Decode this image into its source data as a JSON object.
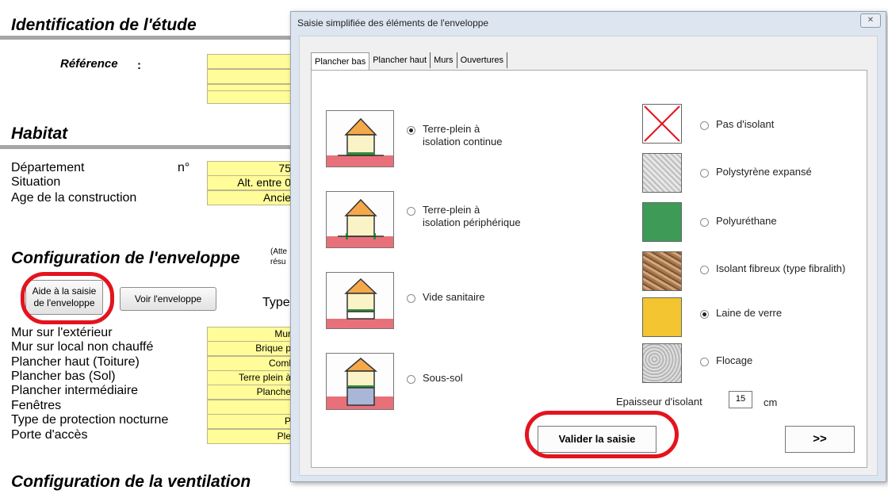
{
  "sheet": {
    "identification_title": "Identification de l'étude",
    "reference_label": "Référence",
    "reference_colon": ":",
    "habitat_title": "Habitat",
    "departement_label": "Département",
    "departement_no": "n°",
    "departement_value": "75",
    "situation_label": "Situation",
    "situation_value": "Alt. entre 0",
    "age_label": "Age de la construction",
    "age_value": "Ancie",
    "config_env_title": "Configuration de l'enveloppe",
    "config_note_1": "(Atte",
    "config_note_2": "résu",
    "aide_button_line1": "Aide à la saisie",
    "aide_button_line2": "de l'enveloppe",
    "voir_button": "Voir l'enveloppe",
    "type_label": "Type",
    "rows": [
      {
        "label": "Mur sur l'extérieur",
        "value": "Mur"
      },
      {
        "label": "Mur sur local non chauffé",
        "value": "Brique p"
      },
      {
        "label": "Plancher haut (Toiture)",
        "value": "Coml"
      },
      {
        "label": "Plancher bas (Sol)",
        "value": "Terre plein à"
      },
      {
        "label": "Plancher intermédiaire",
        "value": "Planche"
      },
      {
        "label": "Fenêtres",
        "value": ""
      },
      {
        "label": "Type de protection nocturne",
        "value": "P"
      },
      {
        "label": "Porte d'accès",
        "value": "Ple"
      }
    ],
    "config_vent_title": "Configuration de la ventilation"
  },
  "dialog": {
    "title": "Saisie simplifiée des éléments de l'enveloppe",
    "close_glyph": "✕",
    "tabs": [
      "Plancher bas",
      "Plancher haut",
      "Murs",
      "Ouvertures"
    ],
    "floor_types": [
      {
        "line1": "Terre-plein à",
        "line2": "isolation continue",
        "selected": true
      },
      {
        "line1": "Terre-plein à",
        "line2": "isolation périphérique",
        "selected": false
      },
      {
        "line1": "Vide sanitaire",
        "line2": "",
        "selected": false
      },
      {
        "line1": "Sous-sol",
        "line2": "",
        "selected": false
      }
    ],
    "materials": [
      {
        "label": "Pas d'isolant",
        "selected": false,
        "icon": "no-insulation-icon"
      },
      {
        "label": "Polystyrène expansé",
        "selected": false,
        "icon": "polystyrene-icon"
      },
      {
        "label": "Polyuréthane",
        "selected": false,
        "icon": "polyurethane-icon"
      },
      {
        "label": "Isolant fibreux (type fibralith)",
        "selected": false,
        "icon": "fibrous-insulation-icon"
      },
      {
        "label": "Laine de verre",
        "selected": true,
        "icon": "glass-wool-icon"
      },
      {
        "label": "Flocage",
        "selected": false,
        "icon": "flocking-icon"
      }
    ],
    "thickness_label": "Epaisseur d'isolant",
    "thickness_value": "15",
    "thickness_unit": "cm",
    "validate_button": "Valider la saisie",
    "next_button": ">>"
  },
  "colors": {
    "cell_yellow": "#fffc99",
    "highlight_red": "#e3141e",
    "roof_orange": "#f5a84a",
    "ground_red": "#e8707a",
    "polyurethane_green": "#3e9a57",
    "glass_wool_yellow": "#f2c531"
  }
}
